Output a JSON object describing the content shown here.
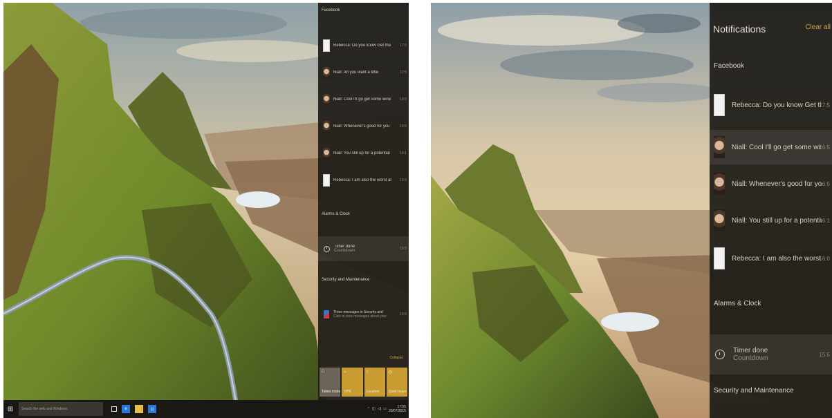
{
  "left": {
    "group_facebook": "Facebook",
    "notifications": [
      {
        "text": "Rebecca: Do you know Get the",
        "time": "17:5"
      },
      {
        "text": "Niall: Ah you want a little",
        "time": "17:5"
      },
      {
        "text": "Niall: Cool I'll go get some wine",
        "time": "16:5"
      },
      {
        "text": "Niall: Whenever's good for you",
        "time": "16:5"
      },
      {
        "text": "Niall: You still up for a potential",
        "time": "16:1"
      },
      {
        "text": "Rebecca: I am also the worst at",
        "time": "16:0"
      }
    ],
    "group_alarms": "Alarms & Clock",
    "timer": {
      "title": "Timer done",
      "sub": "Countdown",
      "time": "15:5"
    },
    "group_security": "Security and Maintenance",
    "security_item": {
      "title": "Three messages in Security and",
      "sub": "Click to view messages about your",
      "time": "15:0"
    },
    "collapse": "Collapse",
    "tiles": [
      {
        "icon": "□",
        "label": "Tablet mode"
      },
      {
        "icon": "⌁",
        "label": "VPN"
      },
      {
        "icon": "☾",
        "label": "Location"
      },
      {
        "icon": "◷",
        "label": "Quiet hours"
      }
    ],
    "search_placeholder": "Search the web and Windows",
    "clock_time": "17:55",
    "clock_date": "20/07/2015"
  },
  "right": {
    "title": "Notifications",
    "clear_all": "Clear all",
    "group_facebook": "Facebook",
    "notifications": [
      {
        "text": "Rebecca: Do you know Get the",
        "time": "17:5"
      },
      {
        "text": "Niall: Cool I'll go get some wine",
        "time": "16:5"
      },
      {
        "text": "Niall: Whenever's good for you",
        "time": "16:5"
      },
      {
        "text": "Niall: You still up for a potential",
        "time": "16:1"
      },
      {
        "text": "Rebecca: I am also the worst at",
        "time": "16:0"
      }
    ],
    "group_alarms": "Alarms & Clock",
    "timer": {
      "title": "Timer done",
      "sub": "Countdown",
      "time": "15:5"
    },
    "group_security": "Security and Maintenance"
  }
}
